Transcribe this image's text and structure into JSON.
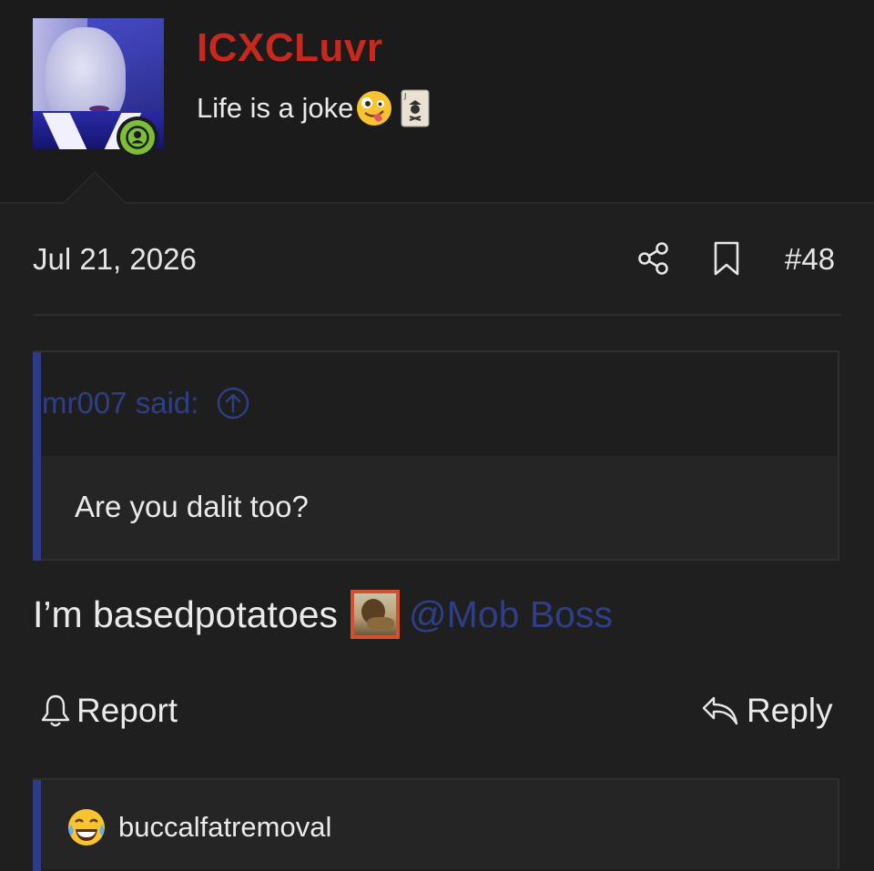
{
  "header": {
    "username": "ICXCLuvr",
    "tagline": "Life is a joke",
    "avatar_icon": "user-avatar-photo",
    "status_icon": "online-user-icon",
    "emojis": [
      "zany-face-icon",
      "joker-card-icon"
    ]
  },
  "meta": {
    "date": "Jul 21, 2026",
    "post_number": "#48",
    "share_icon": "share-icon",
    "bookmark_icon": "bookmark-icon"
  },
  "quote": {
    "attribution": "mr007 said:",
    "text": "Are you dalit too?",
    "jump_icon": "arrow-up-circle-icon"
  },
  "post": {
    "text": "I’m basedpotatoes",
    "image_icon": "lion-emoji-icon",
    "mention": "@Mob Boss"
  },
  "actions": {
    "report_label": "Report",
    "reply_label": "Reply"
  },
  "reactions": {
    "emoji_icon": "tears-of-joy-icon",
    "user": "buccalfatremoval"
  },
  "colors": {
    "background": "#1f1f20",
    "username": "#c8281e",
    "link": "#2f3f86",
    "quote_bar": "#2f3b87",
    "online": "#7cbd3a",
    "image_border": "#d5502f"
  }
}
